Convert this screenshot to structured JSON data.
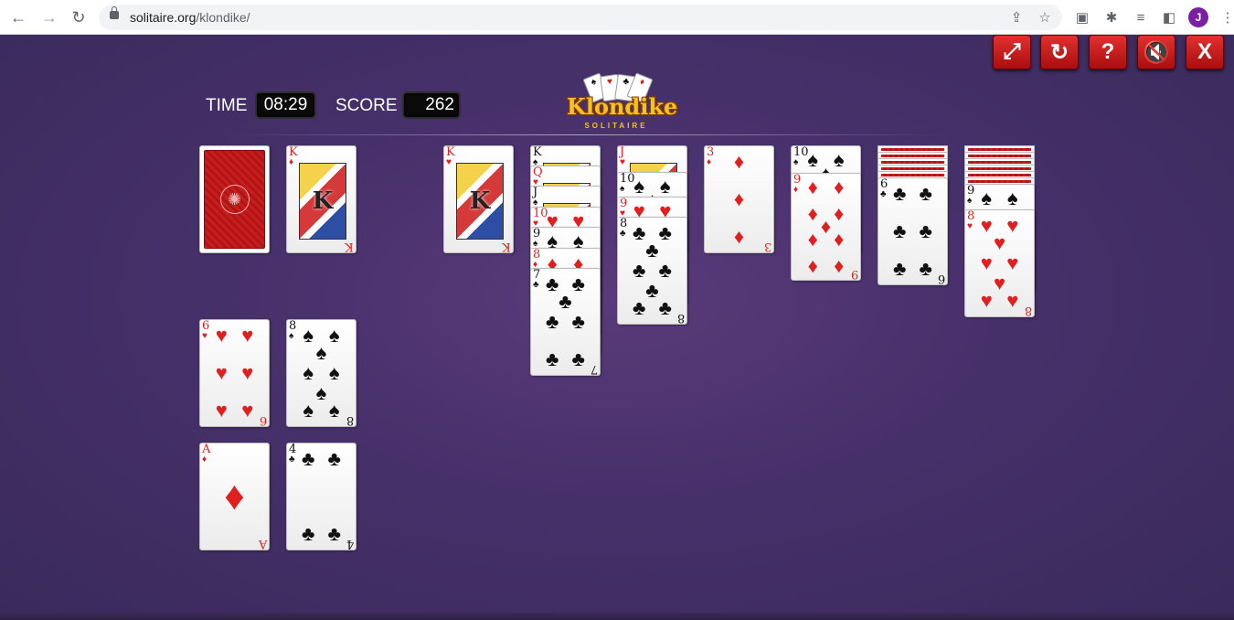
{
  "browser": {
    "url_host": "solitaire.org",
    "url_path": "/klondike/",
    "avatar_letter": "J",
    "icons": [
      "back-arrow-icon",
      "forward-arrow-icon",
      "reload-icon",
      "lock-icon",
      "share-icon",
      "star-icon",
      "extension-puzzle-icon",
      "reading-list-icon",
      "side-panel-icon",
      "menu-dots-icon"
    ]
  },
  "controls": [
    {
      "name": "fullscreen-button",
      "glyph": "⤢"
    },
    {
      "name": "restart-button",
      "glyph": "↻"
    },
    {
      "name": "help-button",
      "glyph": "?"
    },
    {
      "name": "mute-button",
      "glyph": "🔇"
    },
    {
      "name": "close-game-button",
      "glyph": "X"
    }
  ],
  "hud": {
    "time_label": "TIME",
    "time_value": "08:29",
    "score_label": "SCORE",
    "score_value": "262"
  },
  "logo": {
    "title": "Klondike",
    "subtitle": "SOLITAIRE"
  },
  "colors": {
    "table": "#46306a",
    "card_red": "#e02020",
    "card_black": "#111111",
    "control_red": "#c81d1d"
  },
  "stock": {
    "face_down": true
  },
  "waste": {
    "rank": "K",
    "suit": "♦",
    "color": "red"
  },
  "left_piles": [
    {
      "rank": "6",
      "suit": "♥",
      "color": "red"
    },
    {
      "rank": "8",
      "suit": "♠",
      "color": "black"
    },
    {
      "rank": "A",
      "suit": "♦",
      "color": "red"
    },
    {
      "rank": "4",
      "suit": "♣",
      "color": "black"
    }
  ],
  "tableau": [
    {
      "face_down": 0,
      "cards": [
        {
          "rank": "K",
          "suit": "♥",
          "color": "red"
        }
      ]
    },
    {
      "face_down": 0,
      "cards": [
        {
          "rank": "K",
          "suit": "♠",
          "color": "black"
        },
        {
          "rank": "Q",
          "suit": "♥",
          "color": "red"
        },
        {
          "rank": "J",
          "suit": "♠",
          "color": "black"
        },
        {
          "rank": "10",
          "suit": "♥",
          "color": "red"
        },
        {
          "rank": "9",
          "suit": "♠",
          "color": "black"
        },
        {
          "rank": "8",
          "suit": "♦",
          "color": "red"
        },
        {
          "rank": "7",
          "suit": "♣",
          "color": "black"
        }
      ]
    },
    {
      "face_down": 0,
      "cards": [
        {
          "rank": "J",
          "suit": "♥",
          "color": "red"
        },
        {
          "rank": "10",
          "suit": "♠",
          "color": "black"
        },
        {
          "rank": "9",
          "suit": "♥",
          "color": "red"
        },
        {
          "rank": "8",
          "suit": "♣",
          "color": "black"
        }
      ]
    },
    {
      "face_down": 0,
      "cards": [
        {
          "rank": "3",
          "suit": "♦",
          "color": "red"
        }
      ]
    },
    {
      "face_down": 0,
      "cards": [
        {
          "rank": "10",
          "suit": "♠",
          "color": "black"
        },
        {
          "rank": "9",
          "suit": "♦",
          "color": "red"
        }
      ]
    },
    {
      "face_down": 5,
      "cards": [
        {
          "rank": "6",
          "suit": "♣",
          "color": "black"
        }
      ]
    },
    {
      "face_down": 6,
      "cards": [
        {
          "rank": "9",
          "suit": "♠",
          "color": "black"
        },
        {
          "rank": "8",
          "suit": "♥",
          "color": "red"
        }
      ]
    }
  ]
}
